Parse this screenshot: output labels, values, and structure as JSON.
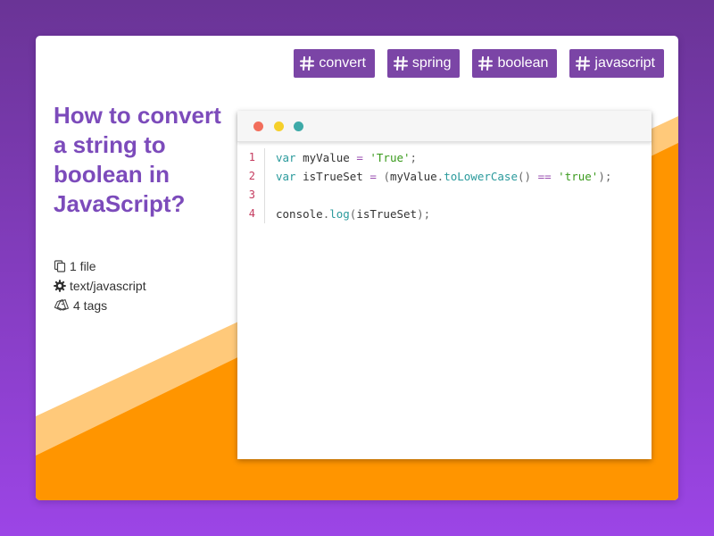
{
  "tags": [
    {
      "label": "convert"
    },
    {
      "label": "spring"
    },
    {
      "label": "boolean"
    },
    {
      "label": "javascript"
    }
  ],
  "title": "How to convert a string to boolean in JavaScript?",
  "meta": {
    "files": "1 file",
    "language": "text/javascript",
    "tags_count": "4 tags"
  },
  "code": {
    "line_numbers": [
      "1",
      "2",
      "3",
      "4"
    ],
    "lines": [
      [
        {
          "t": "var",
          "c": "k"
        },
        {
          "t": " myValue ",
          "c": ""
        },
        {
          "t": "=",
          "c": "o"
        },
        {
          "t": " ",
          "c": ""
        },
        {
          "t": "'True'",
          "c": "s"
        },
        {
          "t": ";",
          "c": "p"
        }
      ],
      [
        {
          "t": "var",
          "c": "k"
        },
        {
          "t": " isTrueSet ",
          "c": ""
        },
        {
          "t": "=",
          "c": "o"
        },
        {
          "t": " ",
          "c": ""
        },
        {
          "t": "(",
          "c": "p"
        },
        {
          "t": "myValue",
          "c": ""
        },
        {
          "t": ".",
          "c": "p"
        },
        {
          "t": "toLowerCase",
          "c": "f"
        },
        {
          "t": "()",
          "c": "p"
        },
        {
          "t": " ",
          "c": ""
        },
        {
          "t": "==",
          "c": "o"
        },
        {
          "t": " ",
          "c": ""
        },
        {
          "t": "'true'",
          "c": "s"
        },
        {
          "t": ");",
          "c": "p"
        }
      ],
      [],
      [
        {
          "t": "console",
          "c": ""
        },
        {
          "t": ".",
          "c": "p"
        },
        {
          "t": "log",
          "c": "f"
        },
        {
          "t": "(",
          "c": "p"
        },
        {
          "t": "isTrueSet",
          "c": ""
        },
        {
          "t": ");",
          "c": "p"
        }
      ]
    ]
  },
  "colors": {
    "background_top": "#6a3496",
    "background_bottom": "#9c45e6",
    "tag_bg": "#7b45a6",
    "title": "#7c4bbb",
    "orange": "#ff9500",
    "light_orange": "#ffc97a"
  },
  "icons": {
    "tag_prefix": "hash-icon",
    "files": "file-copy-icon",
    "language": "gear-icon",
    "tags": "tags-icon"
  }
}
